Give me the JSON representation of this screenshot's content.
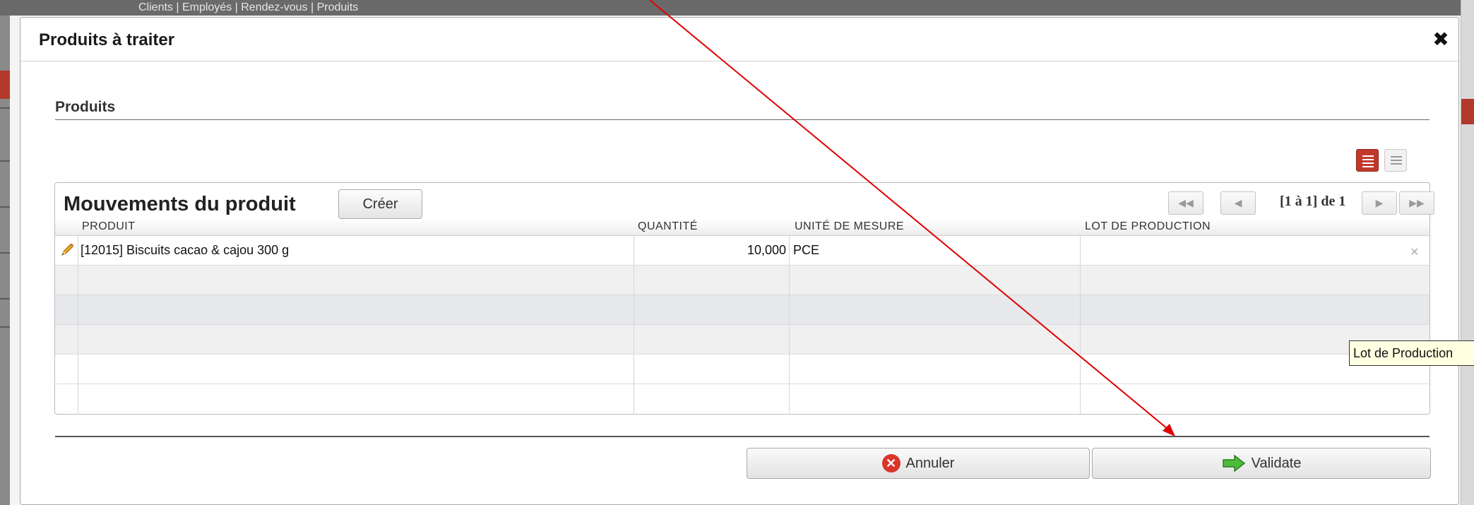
{
  "background": {
    "top_bar_text": "Clients | Employés | Rendez-vous | Produits"
  },
  "modal": {
    "title": "Produits à traiter",
    "close_icon": "close-icon"
  },
  "section": {
    "title": "Produits"
  },
  "view_toggle": {
    "active": "list",
    "list_icon": "list-view-icon",
    "grid_icon": "grid-view-icon"
  },
  "grid": {
    "title": "Mouvements du produit",
    "create_label": "Créer",
    "pager_text": "[1 à 1] de 1",
    "columns": [
      "PRODUIT",
      "QUANTITÉ",
      "UNITÉ DE MESURE",
      "LOT DE PRODUCTION"
    ],
    "rows": [
      {
        "product": "[12015] Biscuits cacao & cajou 300 g",
        "quantity": "10,000",
        "unit": "PCE",
        "lot": ""
      }
    ],
    "remove_glyph": "×"
  },
  "actions": {
    "cancel_label": "Annuler",
    "validate_label": "Validate"
  },
  "tooltip": {
    "text": "Lot de Production"
  },
  "colors": {
    "accent_red": "#c0392b",
    "annotation_arrow": "#e00000",
    "validate_arrow_green": "#3aa83a"
  }
}
